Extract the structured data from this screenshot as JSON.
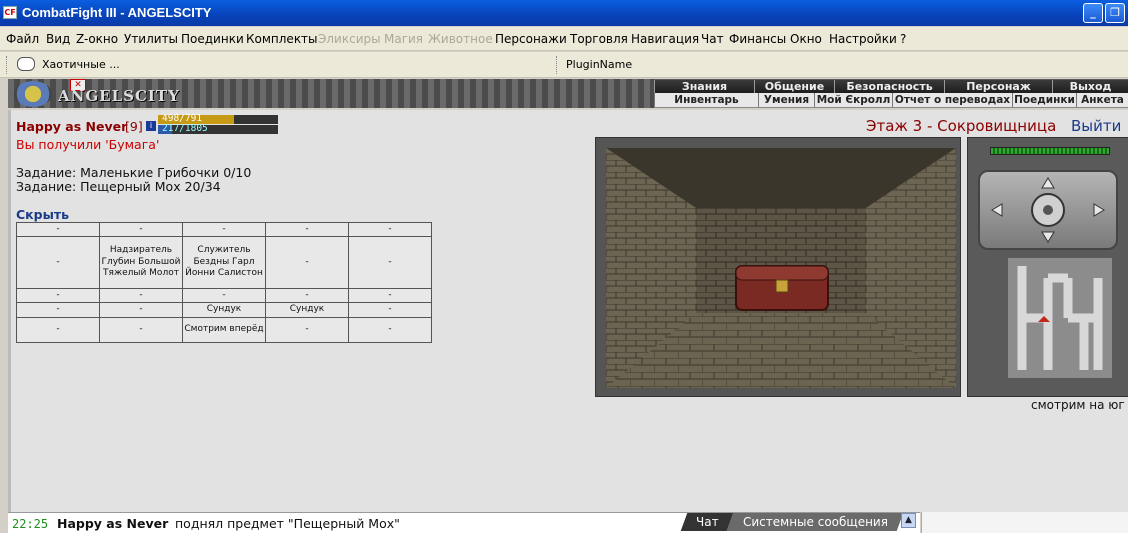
{
  "window": {
    "title": "CombatFight III - ANGELSCITY",
    "icon_text": "CF"
  },
  "menu": [
    {
      "label": "Файл",
      "disabled": false
    },
    {
      "label": "Вид",
      "disabled": false
    },
    {
      "label": "Z-окно",
      "disabled": false
    },
    {
      "label": "Утилиты",
      "disabled": false
    },
    {
      "label": "Поединки",
      "disabled": false
    },
    {
      "label": "Комплекты",
      "disabled": false
    },
    {
      "label": "Эликсиры",
      "disabled": true
    },
    {
      "label": "Магия",
      "disabled": true
    },
    {
      "label": "Животное",
      "disabled": true
    },
    {
      "label": "Персонажи",
      "disabled": false
    },
    {
      "label": "Торговля",
      "disabled": false
    },
    {
      "label": "Навигация",
      "disabled": false
    },
    {
      "label": "Чат",
      "disabled": false
    },
    {
      "label": "Финансы",
      "disabled": false
    },
    {
      "label": "Окно",
      "disabled": false
    },
    {
      "label": "Настройки",
      "disabled": false
    },
    {
      "label": "?",
      "disabled": false
    }
  ],
  "toolbar": {
    "left_label": "Хаотичные ...",
    "right_label": "PluginName"
  },
  "game_nav": {
    "top": [
      "Знания",
      "Общение",
      "Безопасность",
      "Персонаж",
      "Выход"
    ],
    "bottom": [
      "Инвентарь",
      "Умения",
      "Мой Єкролл",
      "Отчет о переводах",
      "Поединки",
      "Анкета"
    ]
  },
  "logo_text": "ANGELSCITY",
  "player": {
    "name": "Happy as Never",
    "level": "[9]",
    "hp": "498/791",
    "hp_fraction": 0.63,
    "mp": "217/1805",
    "mp_fraction": 0.12
  },
  "message": "Вы получили 'Бумага'",
  "quests": [
    "Задание: Маленькие Грибочки 0/10",
    "Задание: Пещерный Мох 20/34"
  ],
  "hide_label": "Скрыть",
  "cells": [
    [
      "-",
      "-",
      "-",
      "-",
      "-"
    ],
    [
      "-",
      "Надзиратель Глубин Большой Тяжелый Молот",
      "Служитель Бездны Гарл Йонни Салистон",
      "-",
      "-"
    ],
    [
      "-",
      "-",
      "-",
      "-",
      "-"
    ],
    [
      "-",
      "-",
      "Сундук",
      "Сундук",
      "-"
    ],
    [
      "-",
      "-",
      "Смотрим вперёд",
      "-",
      "-"
    ]
  ],
  "location": "Этаж 3 - Сокровищница",
  "exit_label": "Выйти",
  "facing": "смотрим на юг",
  "chat": {
    "time": "22:25",
    "name": "Happy as Never",
    "text": "поднял предмет \"Пещерный Мох\"",
    "tabs": [
      "Чат",
      "Системные сообщения"
    ]
  },
  "colors": {
    "accent": "#8b0000",
    "link": "#1a3a8a",
    "hp": "#c79a16",
    "mp": "#2b5aa8"
  }
}
